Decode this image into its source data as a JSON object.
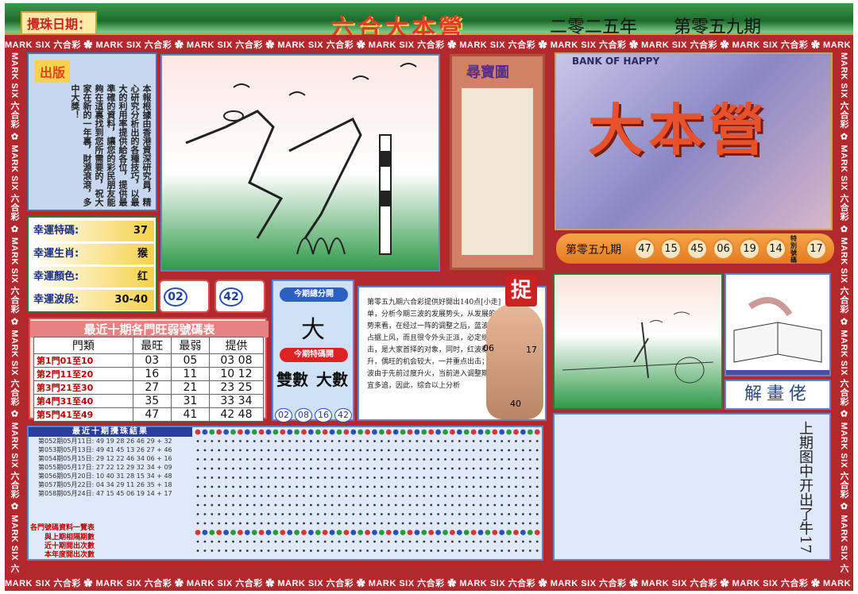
{
  "header": {
    "date_label": "攪珠日期：",
    "title": "六合大本營",
    "year": "二零二五年",
    "issue": "第零五九期"
  },
  "border": {
    "repeat_text": "MARK SIX 六合彩"
  },
  "publication": {
    "tag": "出版",
    "text": "本報根據由香港資深研究員，精心研究分析出的各種技巧，以最大的利用率提供給各位，提供最準確的資料，讓您的彩民朋友能夠在這裏找到您所需要的，祝大家在新的一年裏，財源滾滾，多中大獎！"
  },
  "lucky": [
    {
      "label": "幸運特碼:",
      "value": "37"
    },
    {
      "label": "幸運生肖:",
      "value": "猴"
    },
    {
      "label": "幸運顏色:",
      "value": "红"
    },
    {
      "label": "幸運波段:",
      "value": "30-40"
    }
  ],
  "scroll": {
    "title": "尋寶圖"
  },
  "banner": {
    "bank": "BANK OF HAPPY",
    "text": "大本營"
  },
  "result": {
    "period": "第零五九期",
    "balls": [
      "47",
      "15",
      "45",
      "06",
      "19",
      "14"
    ],
    "special_label": "特別號碼",
    "special": "17"
  },
  "mini": [
    {
      "num": "02"
    },
    {
      "num": "42"
    }
  ],
  "stats": {
    "title": "最近十期各門旺弱號碼表",
    "headers": [
      "門類",
      "最旺",
      "最弱",
      "提供"
    ],
    "rows": [
      {
        "gate": "第1門01至10",
        "hot": "03",
        "cold": "05",
        "give": "03 08"
      },
      {
        "gate": "第2門11至20",
        "hot": "16",
        "cold": "11",
        "give": "10 12"
      },
      {
        "gate": "第3門21至30",
        "hot": "27",
        "cold": "21",
        "give": "23 25"
      },
      {
        "gate": "第4門31至40",
        "hot": "35",
        "cold": "31",
        "give": "33 34"
      },
      {
        "gate": "第5門41至49",
        "hot": "47",
        "cold": "41",
        "give": "42 48"
      }
    ]
  },
  "center": {
    "label1": "今期總分開",
    "value": "大",
    "label2": "今期特碼開",
    "opt_a": "雙數",
    "opt_b": "大數",
    "balls": [
      "02",
      "08",
      "16",
      "42"
    ]
  },
  "analysis": {
    "tag": "捉",
    "text": "第零五九期六合彩提供好開出140点[小走]单，分析今期三波的发展势头，从发展的趋势来看，在经过一阵的调整之后，蓝波明天占据上风，而且很令外头正派，必定继续出击，是大家首择的对象，同时，红波稳中有升，偶旺的机会较大，一并重点出击；而绿波由于先前过度升火，当前进入调整期，不宜多追，因此，综合以上分析",
    "nums": [
      "06",
      "17",
      "40"
    ]
  },
  "jiehua": {
    "label": "解畫佬"
  },
  "history": {
    "title": "最近十期攪珠結果",
    "rows": [
      "第052期05月11日: 49 19 28 26 46 29 + 32",
      "第053期05月13日: 49 41 45 13 26 27 + 46",
      "第054期05月15日: 29 12 22 46 34 06 + 16",
      "第055期05月17日: 27 22 12 29 32 34 + 09",
      "第056期05月20日: 10 40 31 28 15 34 + 48",
      "第057期05月22日: 04 34 29 11 26 35 + 18",
      "第058期05月24日: 47 15 45 06 19 14 + 17"
    ],
    "foot_title": "各門號碼資料一覽表",
    "foot_rows": [
      "與上期相隔期數",
      "近十期開出次數",
      "本年度開出次數"
    ]
  },
  "lastnote": {
    "text": "上期图中开出了牛17"
  }
}
